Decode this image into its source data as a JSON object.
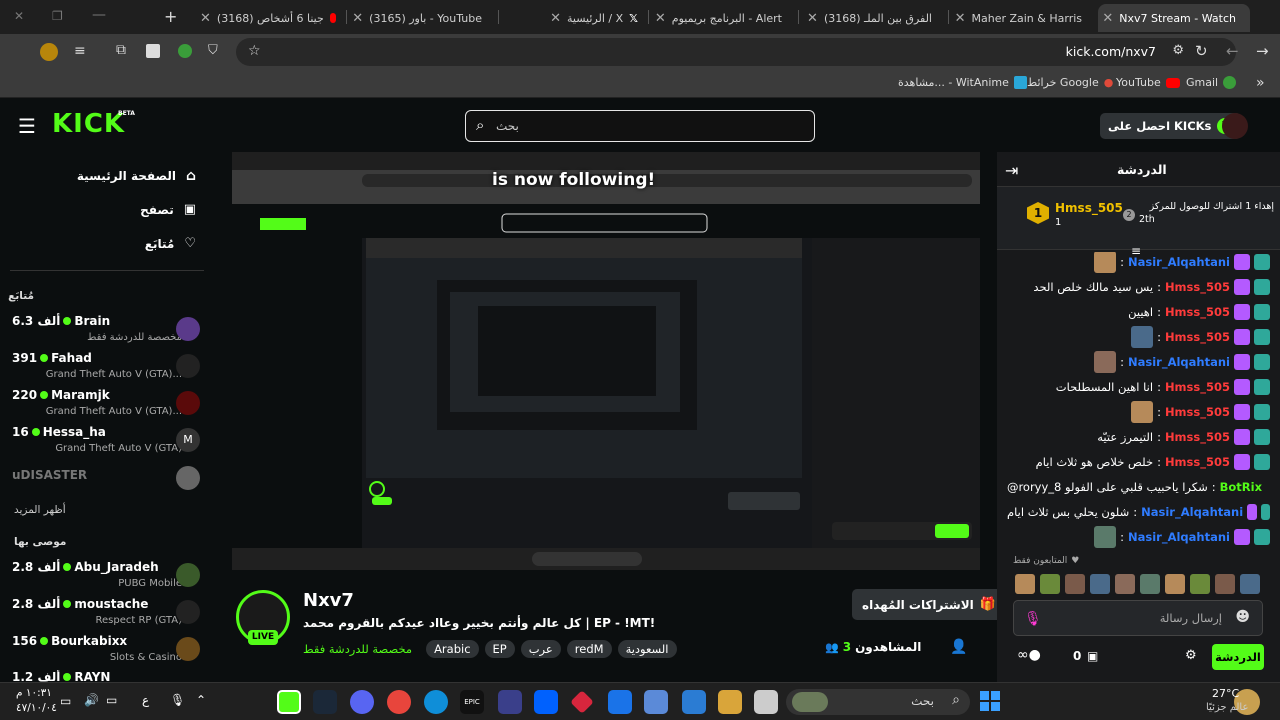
{
  "browser": {
    "tabs": [
      {
        "label": "Nxv7 Stream - Watch",
        "active": true
      },
      {
        "label": "Maher Zain & Harris"
      },
      {
        "label": "(3168) الفرق بين الملـ"
      },
      {
        "label": "البرنامج بريميوم - Alert"
      },
      {
        "label": "الرئيسية / X"
      },
      {
        "label": "(3165) باور - YouTube"
      },
      {
        "label": "(3168) جينا 6 أشخاص"
      }
    ],
    "url": "kick.com/nxv7",
    "bookmarks": [
      "Gmail",
      "YouTube",
      "خرائط Google",
      "مشاهدة... - WitAnime"
    ]
  },
  "header": {
    "logo": "KICK",
    "logo_tag": "BETA",
    "search_placeholder": "بحث",
    "get_kicks": "احصل على KICKs"
  },
  "sidebar": {
    "nav": [
      "الصفحة الرئيسية",
      "تصفح",
      "مُتابَع"
    ],
    "following_title": "مُتابَع",
    "following": [
      {
        "name": "Brain",
        "viewers": "6.3 ألف",
        "game": "مخصصة للدردشة فقط"
      },
      {
        "name": "Fahad",
        "viewers": "391",
        "game": "Grand Theft Auto V (GTA)..."
      },
      {
        "name": "Maramjk",
        "viewers": "220",
        "game": "Grand Theft Auto V (GTA)..."
      },
      {
        "name": "Hessa_ha",
        "viewers": "16",
        "game": "Grand Theft Auto V (GTA)"
      }
    ],
    "offline": "uDISASTER",
    "show_more": "أظهر المزيد",
    "recommended_title": "موصى بها",
    "recommended": [
      {
        "name": "Abu_Jaradeh",
        "viewers": "2.8 ألف",
        "game": "PUBG Mobile"
      },
      {
        "name": "moustache",
        "viewers": "2.8 ألف",
        "game": "Respect RP (GTA)"
      },
      {
        "name": "Bourkabixx",
        "viewers": "156",
        "game": "Slots & Casino"
      },
      {
        "name": "RAYN",
        "viewers": "1.2 ألف",
        "game": ""
      }
    ]
  },
  "overlay": {
    "following_text": "is now following!"
  },
  "stream": {
    "channel": "Nxv7",
    "live": "LIVE",
    "title": "كل عالم وأنتم بخيير وعااد عيدكم بالقروم محمد | EP - !MT!",
    "category": "مخصصة للدردشة فقط",
    "tags": [
      "السعودية",
      "redM",
      "عرب",
      "EP",
      "Arabic"
    ],
    "viewers_label": "المشاهدون",
    "viewers": "3",
    "gift_subs": "الاشتراكات المُهداه"
  },
  "chat": {
    "title": "الدردشة",
    "leader_name": "Hmss_505",
    "leader_count": "1",
    "leader_rank": "2th",
    "leader_text": "إهداء 1 اشتراك للوصول للمركز",
    "messages": [
      {
        "user": "Nasir_Alqahtani",
        "text": "",
        "color": "#2f7cff"
      },
      {
        "user": "Hmss_505",
        "text": "يس سيد مالك خلص الحد",
        "color": "#ff3b3b"
      },
      {
        "user": "Hmss_505",
        "text": "اهيين",
        "color": "#ff3b3b"
      },
      {
        "user": "Hmss_505",
        "text": "",
        "color": "#ff3b3b"
      },
      {
        "user": "Nasir_Alqahtani",
        "text": "",
        "color": "#2f7cff"
      },
      {
        "user": "Hmss_505",
        "text": "انا اهين المسطلحات",
        "color": "#ff3b3b"
      },
      {
        "user": "Hmss_505",
        "text": "",
        "color": "#ff3b3b"
      },
      {
        "user": "Hmss_505",
        "text": "التيمرز عتيّه",
        "color": "#ff3b3b"
      },
      {
        "user": "Hmss_505",
        "text": "خلص خلاص هو ثلاث ايام",
        "color": "#ff3b3b"
      },
      {
        "user": "BotRix",
        "text": "@roryy_8 شكرا ياحبيب قلبي على الفولو",
        "color": "#53fc18"
      },
      {
        "user": "Nasir_Alqahtani",
        "text": "شلون يحلي بس ثلاث ايام",
        "color": "#2f7cff"
      },
      {
        "user": "Nasir_Alqahtani",
        "text": "",
        "color": "#2f7cff"
      }
    ],
    "followers_only": "المتابعون فقط",
    "input_placeholder": "إرسال رسالة",
    "send": "الدردشة",
    "points": "0"
  },
  "taskbar": {
    "temp": "27°C",
    "weather": "عالم جزئيًا",
    "search": "بحث",
    "time": "١٠:٣١ م",
    "date": "٤٧/١٠/٠٤",
    "lang": "ع"
  }
}
